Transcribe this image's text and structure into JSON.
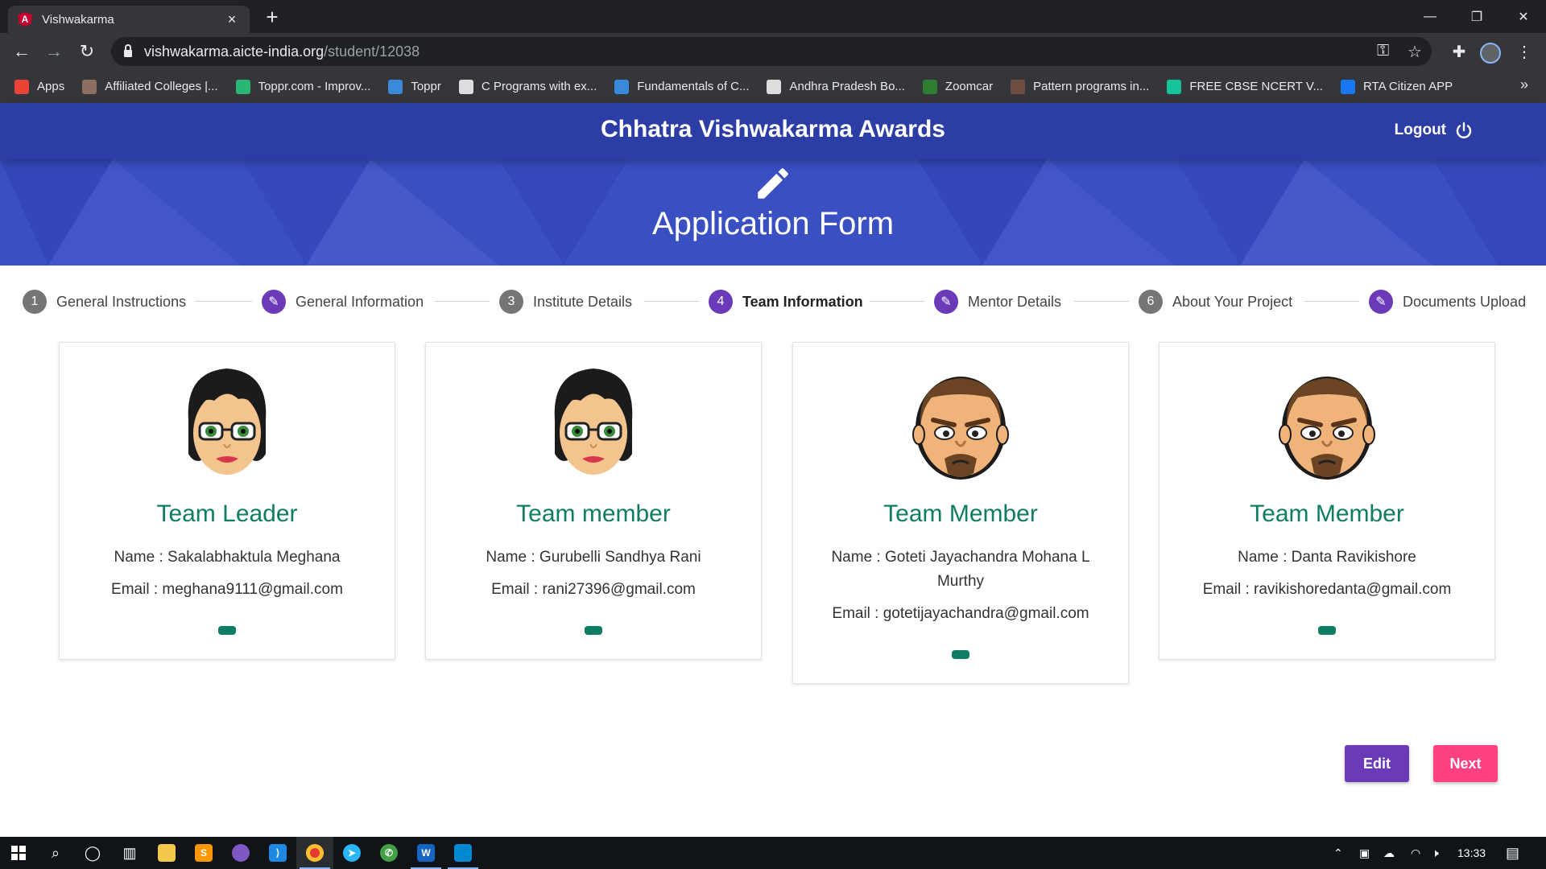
{
  "browser": {
    "tab_title": "Vishwakarma",
    "tab_close": "×",
    "new_tab": "+",
    "url_domain": "vishwakarma.aicte-india.org",
    "url_path": "/student/12038",
    "bookmarks": [
      {
        "label": "Apps",
        "icon": "apps-grid-icon",
        "color": "#ea4335"
      },
      {
        "label": "Affiliated Colleges |...",
        "icon": "college-icon",
        "color": "#8d6e63"
      },
      {
        "label": "Toppr.com - Improv...",
        "icon": "toppr-icon",
        "color": "#2bb673"
      },
      {
        "label": "Toppr",
        "icon": "wordpress-icon",
        "color": "#3b8ad9"
      },
      {
        "label": "C Programs with ex...",
        "icon": "globe-icon",
        "color": "#dddddd"
      },
      {
        "label": "Fundamentals of C...",
        "icon": "wordpress-icon",
        "color": "#3b8ad9"
      },
      {
        "label": "Andhra Pradesh Bo...",
        "icon": "globe-icon",
        "color": "#dddddd"
      },
      {
        "label": "Zoomcar",
        "icon": "zoomcar-icon",
        "color": "#2e7d32"
      },
      {
        "label": "Pattern programs in...",
        "icon": "pattern-icon",
        "color": "#6d4c41"
      },
      {
        "label": "FREE CBSE NCERT V...",
        "icon": "grammarly-icon",
        "color": "#15c39a"
      },
      {
        "label": "RTA Citizen APP",
        "icon": "facebook-icon",
        "color": "#1877f2"
      }
    ],
    "bookmarks_more": "»"
  },
  "header": {
    "title": "Chhatra Vishwakarma Awards",
    "logout_label": "Logout"
  },
  "hero": {
    "title": "Application Form"
  },
  "stepper": [
    {
      "label": "General Instructions",
      "marker": "1",
      "state": "num"
    },
    {
      "label": "General Information",
      "marker": "✎",
      "state": "edit"
    },
    {
      "label": "Institute Details",
      "marker": "3",
      "state": "num"
    },
    {
      "label": "Team Information",
      "marker": "4",
      "state": "active"
    },
    {
      "label": "Mentor Details",
      "marker": "✎",
      "state": "edit"
    },
    {
      "label": "About Your Project",
      "marker": "6",
      "state": "num"
    },
    {
      "label": "Documents Upload",
      "marker": "✎",
      "state": "edit"
    }
  ],
  "team": [
    {
      "role": "Team Leader",
      "name": "Name : Sakalabhaktula Meghana",
      "email": "Email : meghana9111@gmail.com",
      "avatar": "female"
    },
    {
      "role": "Team member",
      "name": "Name : Gurubelli Sandhya Rani",
      "email": "Email : rani27396@gmail.com",
      "avatar": "female"
    },
    {
      "role": "Team Member",
      "name": "Name : Goteti Jayachandra Mohana L Murthy",
      "email": "Email : gotetijayachandra@gmail.com",
      "avatar": "male"
    },
    {
      "role": "Team Member",
      "name": "Name : Danta Ravikishore",
      "email": "Email : ravikishoredanta@gmail.com",
      "avatar": "male"
    }
  ],
  "actions": {
    "edit_label": "Edit",
    "next_label": "Next"
  },
  "taskbar": {
    "time": "13:33"
  },
  "colors": {
    "header_blue": "#2c3ea6",
    "hero_blue": "#3a4fc1",
    "accent_purple": "#6a3ab9",
    "role_green": "#0e7d63",
    "next_pink": "#ff4081"
  }
}
